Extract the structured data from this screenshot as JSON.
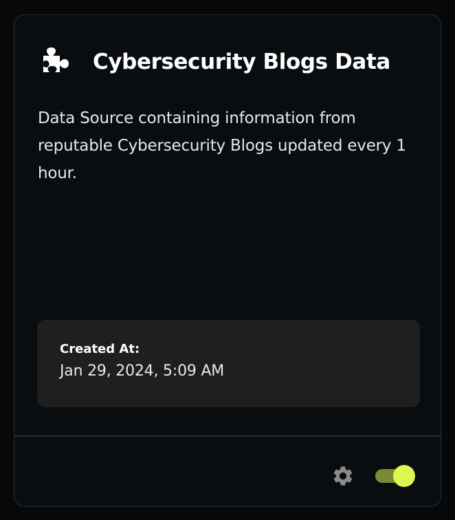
{
  "card": {
    "title": "Cybersecurity Blogs Data",
    "icon": "puzzle-piece-icon",
    "description": "Data Source containing information from reputable Cybersecurity Blogs updated every 1 hour.",
    "meta": {
      "created_label": "Created At:",
      "created_value": "Jan 29, 2024, 5:09 AM"
    },
    "footer": {
      "settings_icon": "gear-icon",
      "toggle_state": "on"
    }
  },
  "colors": {
    "background": "#0a0d10",
    "border": "#2c2f33",
    "meta_box": "#1f1f1f",
    "toggle_track": "#7b8a33",
    "toggle_thumb": "#dcf74f",
    "gear": "#8a8a8a"
  }
}
